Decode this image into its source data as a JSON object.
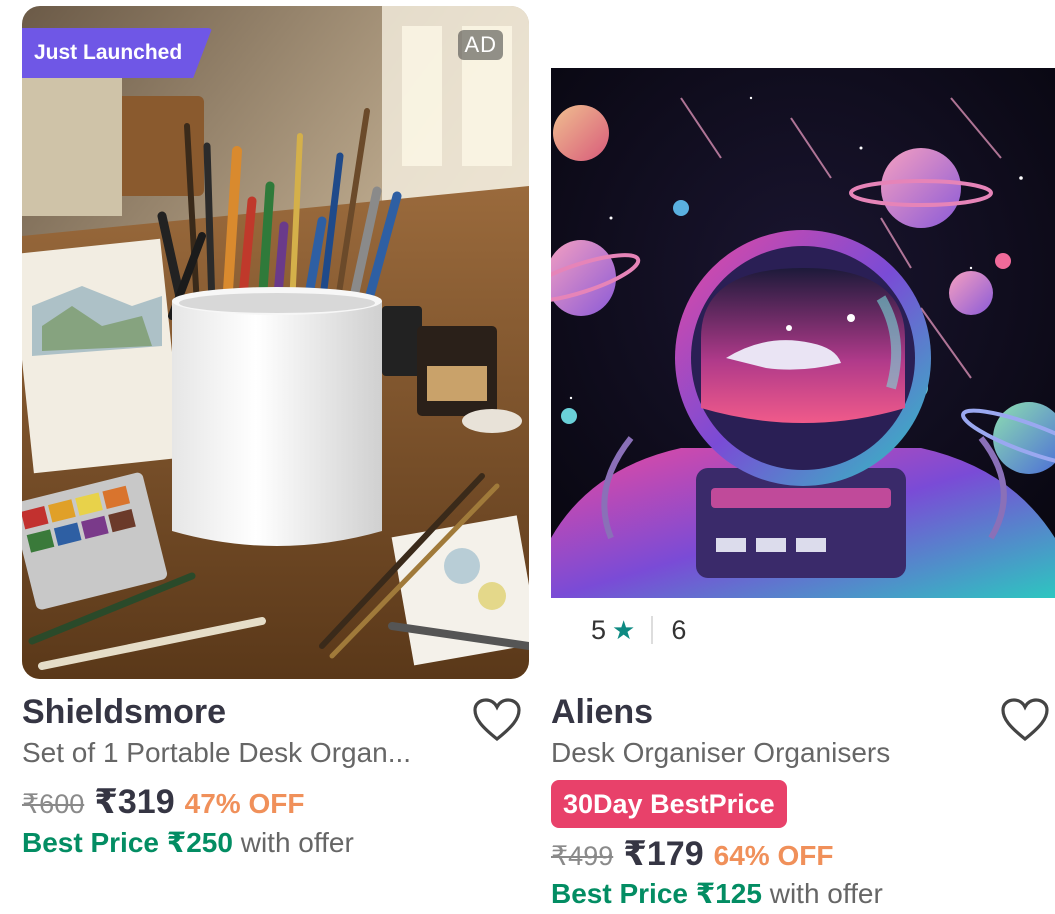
{
  "products": [
    {
      "badge": "Just Launched",
      "ad": "AD",
      "brand": "Shieldsmore",
      "name": "Set of 1 Portable Desk Organ...",
      "mrp": "₹600",
      "price": "₹319",
      "discount": "47% OFF",
      "best_price": "Best Price ₹250",
      "with_offer": " with offer",
      "image": "white pen holder with pencils and brushes on wooden desk",
      "colors": {
        "badge": "#6f57e6",
        "discount": "#f0905a",
        "best": "#038d63"
      }
    },
    {
      "rating": "5",
      "reviews": "6",
      "brand": "Aliens",
      "name": "Desk Organiser Organisers",
      "deal": "30Day BestPrice",
      "mrp": "₹499",
      "price": "₹179",
      "discount": "64% OFF",
      "best_price": "Best Price ₹125",
      "with_offer": " with offer",
      "image": "astronaut with whale in visor and planets in space",
      "colors": {
        "deal": "#e8416a",
        "star": "#0e8a82"
      }
    }
  ],
  "icons": [
    "heart-icon",
    "star-icon"
  ]
}
